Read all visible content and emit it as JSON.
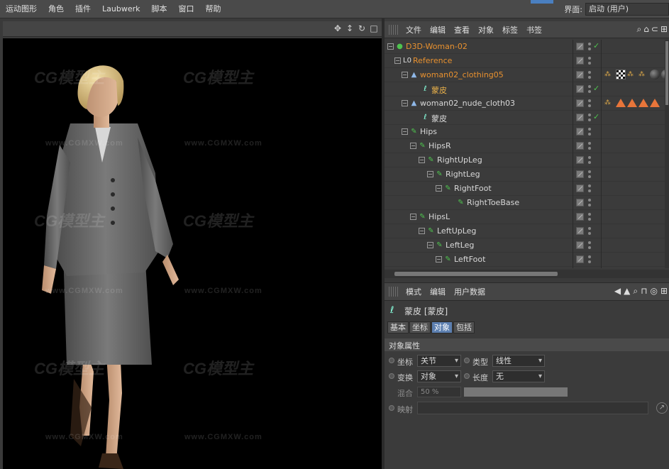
{
  "menubar": {
    "items": [
      "运动图形",
      "角色",
      "插件",
      "Laubwerk",
      "脚本",
      "窗口",
      "帮助"
    ],
    "layout_label": "界面:",
    "layout_value": "启动 (用户)"
  },
  "viewport": {
    "watermark_big": "CG模型主",
    "watermark_url": "www.CGMXW.com"
  },
  "object_manager": {
    "menu": [
      "文件",
      "编辑",
      "查看",
      "对象",
      "标签",
      "书签"
    ],
    "rows": [
      {
        "label": "D3D-Woman-02",
        "color": "#e8912f"
      },
      {
        "label": "Reference",
        "color": "#e8912f"
      },
      {
        "label": "woman02_clothing05",
        "color": "#e8912f"
      },
      {
        "label": "蒙皮",
        "color": "#e8b04a"
      },
      {
        "label": "woman02_nude_cloth03",
        "color": "#d8d8d8"
      },
      {
        "label": "蒙皮",
        "color": "#d8d8d8"
      },
      {
        "label": "Hips",
        "color": "#d8d8d8"
      },
      {
        "label": "HipsR",
        "color": "#d8d8d8"
      },
      {
        "label": "RightUpLeg",
        "color": "#d8d8d8"
      },
      {
        "label": "RightLeg",
        "color": "#d8d8d8"
      },
      {
        "label": "RightFoot",
        "color": "#d8d8d8"
      },
      {
        "label": "RightToeBase",
        "color": "#d8d8d8"
      },
      {
        "label": "HipsL",
        "color": "#d8d8d8"
      },
      {
        "label": "LeftUpLeg",
        "color": "#d8d8d8"
      },
      {
        "label": "LeftLeg",
        "color": "#d8d8d8"
      },
      {
        "label": "LeftFoot",
        "color": "#d8d8d8"
      }
    ]
  },
  "attribute_manager": {
    "menu": [
      "模式",
      "编辑",
      "用户数据"
    ],
    "title": "蒙皮 [蒙皮]",
    "tabs": [
      "基本",
      "坐标",
      "对象",
      "包括"
    ],
    "active_tab": "对象",
    "section": "对象属性",
    "fields": {
      "coord_label": "坐标",
      "coord_value": "关节",
      "type_label": "类型",
      "type_value": "线性",
      "transform_label": "变换",
      "transform_value": "对象",
      "length_label": "长度",
      "length_value": "无",
      "blend_label": "混合",
      "blend_value": "50 %",
      "map_label": "映射"
    }
  }
}
